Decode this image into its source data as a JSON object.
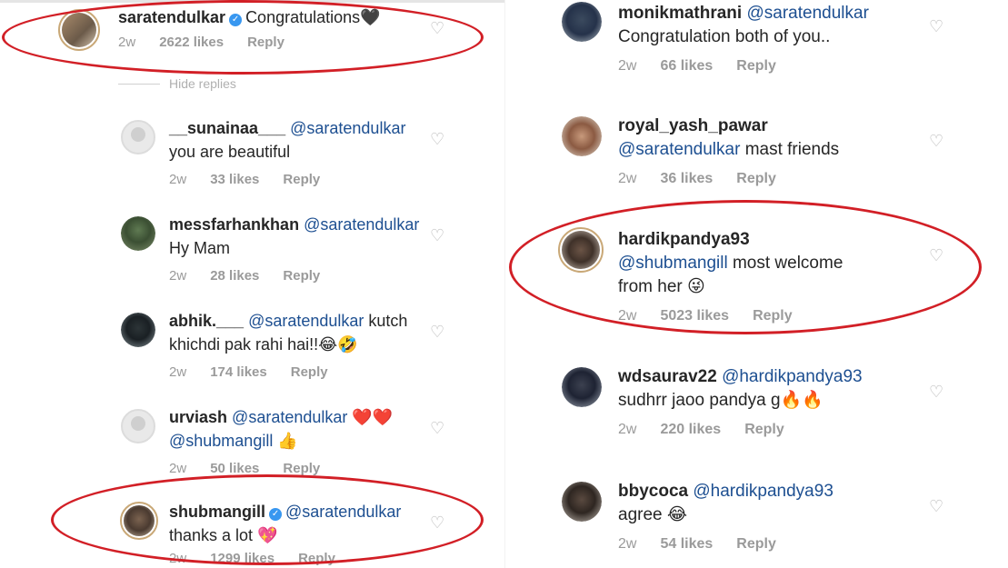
{
  "left": {
    "hide_replies": "Hide replies",
    "comments": [
      {
        "user": "saratendulkar",
        "verified": true,
        "lines": [
          {
            "mention": "",
            "text": "Congratulations🖤"
          }
        ],
        "time": "2w",
        "likes": "2622 likes",
        "reply": "Reply",
        "avatar": "story"
      },
      {
        "user": "__sunainaa___",
        "verified": false,
        "lines": [
          {
            "mention": "@saratendulkar",
            "text": ""
          },
          {
            "mention": "",
            "text": "you are beautiful"
          }
        ],
        "time": "2w",
        "likes": "33 likes",
        "reply": "Reply",
        "avatar": "blank"
      },
      {
        "user": "messfarhankhan",
        "verified": false,
        "lines": [
          {
            "mention": "@saratendulkar",
            "text": ""
          },
          {
            "mention": "",
            "text": "Hy Mam"
          }
        ],
        "time": "2w",
        "likes": "28 likes",
        "reply": "Reply",
        "avatar": "photo"
      },
      {
        "user": "abhik.___",
        "verified": false,
        "lines": [
          {
            "mention": "@saratendulkar",
            "text": " kutch"
          },
          {
            "mention": "",
            "text": "khichdi pak rahi hai!!😂🤣"
          }
        ],
        "time": "2w",
        "likes": "174 likes",
        "reply": "Reply",
        "avatar": "photo"
      },
      {
        "user": "urviash",
        "verified": false,
        "lines": [
          {
            "mention": "@saratendulkar",
            "text": " ❤️❤️"
          },
          {
            "mention": "@shubmangill",
            "text": " 👍"
          }
        ],
        "time": "2w",
        "likes": "50 likes",
        "reply": "Reply",
        "avatar": "blank"
      },
      {
        "user": "shubmangill",
        "verified": true,
        "lines": [
          {
            "mention": "@saratendulkar",
            "text": ""
          },
          {
            "mention": "",
            "text": "thanks a lot 💖"
          }
        ],
        "time": "2w",
        "likes": "1299 likes",
        "reply": "Reply",
        "avatar": "story"
      }
    ]
  },
  "right": {
    "comments": [
      {
        "user": "monikmathrani",
        "verified": false,
        "lines": [
          {
            "mention": "@saratendulkar",
            "text": ""
          },
          {
            "mention": "",
            "text": "Congratulation both of you.."
          }
        ],
        "time": "2w",
        "likes": "66 likes",
        "reply": "Reply",
        "avatar": "photo"
      },
      {
        "user": "royal_yash_pawar",
        "verified": false,
        "lines": [
          {
            "mention": "",
            "text": ""
          },
          {
            "mention": "@saratendulkar",
            "text": " mast friends"
          }
        ],
        "time": "2w",
        "likes": "36 likes",
        "reply": "Reply",
        "avatar": "photo"
      },
      {
        "user": "hardikpandya93",
        "verified": false,
        "lines": [
          {
            "mention": "",
            "text": ""
          },
          {
            "mention": "@shubmangill",
            "text": " most welcome"
          },
          {
            "mention": "",
            "text": "from her 😜"
          }
        ],
        "time": "2w",
        "likes": "5023 likes",
        "reply": "Reply",
        "avatar": "story"
      },
      {
        "user": "wdsaurav22",
        "verified": false,
        "lines": [
          {
            "mention": "@hardikpandya93",
            "text": ""
          },
          {
            "mention": "",
            "text": "sudhrr jaoo pandya g🔥🔥"
          }
        ],
        "time": "2w",
        "likes": "220 likes",
        "reply": "Reply",
        "avatar": "photo"
      },
      {
        "user": "bbycoca",
        "verified": false,
        "lines": [
          {
            "mention": "@hardikpandya93",
            "text": ""
          },
          {
            "mention": "",
            "text": "agree 😂"
          }
        ],
        "time": "2w",
        "likes": "54 likes",
        "reply": "Reply",
        "avatar": "photo"
      }
    ]
  },
  "heart_icon": "♡",
  "verified_icon": "✓",
  "highlight_color": "#d21f26",
  "mention_color": "#1d4f91"
}
